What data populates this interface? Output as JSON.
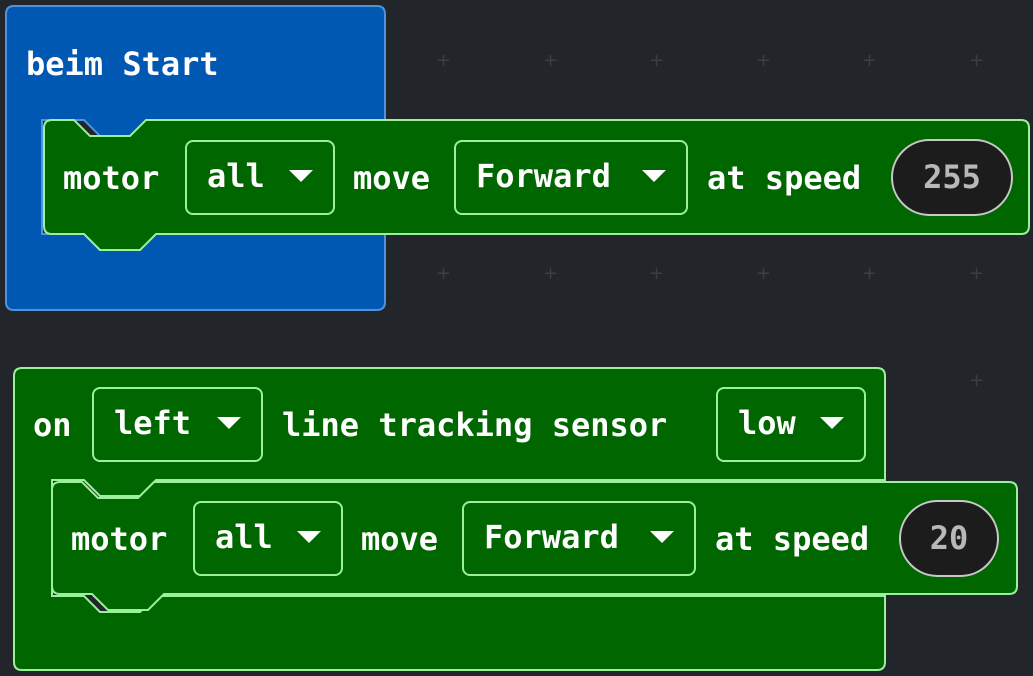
{
  "workspace": {
    "colors": {
      "background": "#22262a",
      "events_block": "#0058b3",
      "motor_block": "#006600",
      "outline_light_green": "#9bf09b"
    }
  },
  "start_block": {
    "label": "beim Start",
    "motor": {
      "label_motor": "motor",
      "motor_value": "all",
      "label_move": "move",
      "direction_value": "Forward",
      "label_speed": "at speed",
      "speed_value": "255"
    }
  },
  "sensor_block": {
    "label_on": "on",
    "side_value": "left",
    "label_sensor": "line tracking sensor",
    "level_value": "low",
    "motor": {
      "label_motor": "motor",
      "motor_value": "all",
      "label_move": "move",
      "direction_value": "Forward",
      "label_speed": "at speed",
      "speed_value": "20"
    }
  }
}
